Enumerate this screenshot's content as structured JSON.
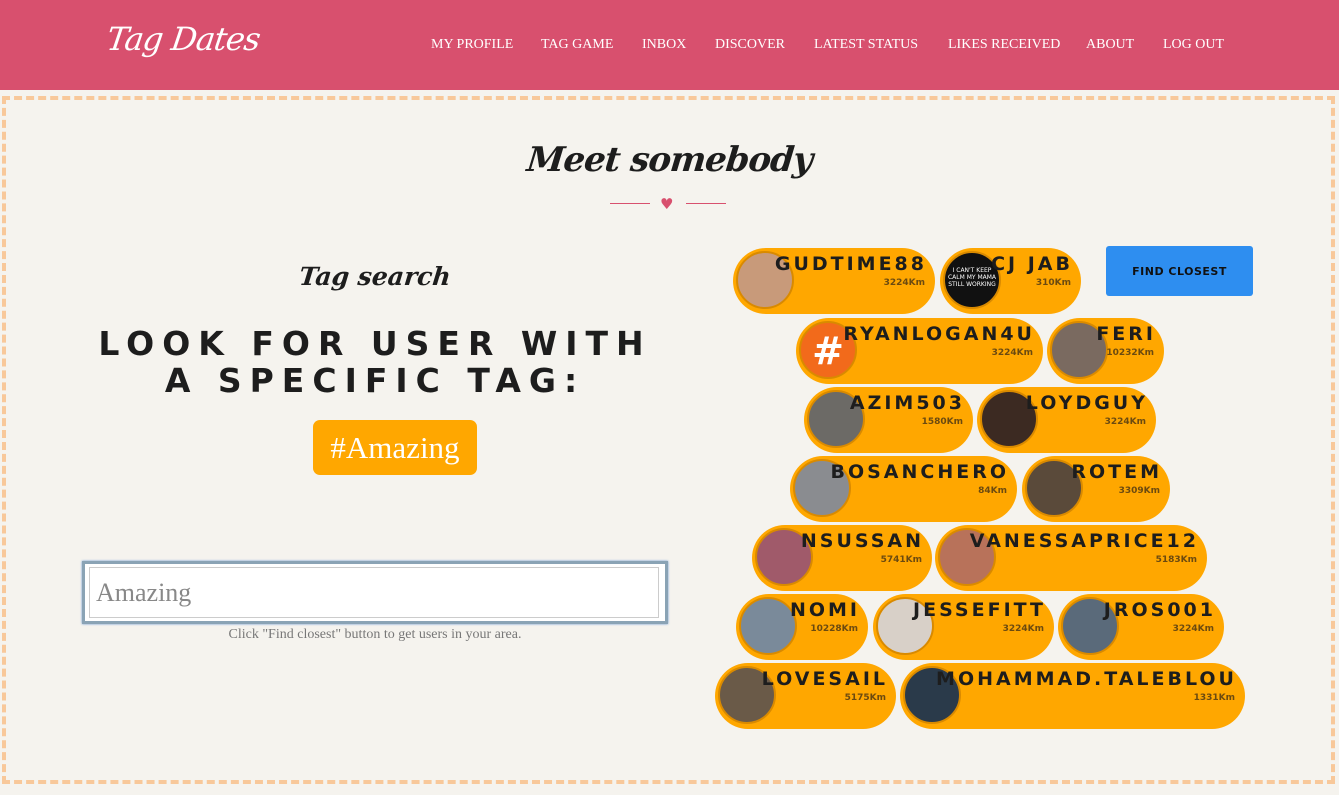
{
  "header": {
    "logo": "Tag Dates",
    "nav": [
      "MY PROFILE",
      "TAG GAME",
      "INBOX",
      "DISCOVER",
      "LATEST STATUS",
      "LIKES RECEIVED",
      "ABOUT",
      "LOG OUT"
    ]
  },
  "main": {
    "title": "Meet somebody",
    "tag_search_heading": "Tag search",
    "look_for_text": "LOOK FOR USER WITH A SPECIFIC TAG:",
    "current_tag": "#Amazing",
    "search_input_value": "Amazing",
    "hint": "Click \"Find closest\" button to get users in your area.",
    "find_closest_label": "FIND CLOSEST"
  },
  "users": [
    {
      "name": "GUDTIME88",
      "distance": "3224Km",
      "avatar_color": "#c89a7a"
    },
    {
      "name": "CJ JAB",
      "distance": "310Km",
      "avatar_color": "#111111",
      "avatar_text": "I CAN'T KEEP CALM MY MAMA STILL WORKING"
    },
    {
      "name": "RYANLOGAN4U",
      "distance": "3224Km",
      "avatar_color": "#f26a1b",
      "avatar_icon": "#"
    },
    {
      "name": "FERI",
      "distance": "10232Km",
      "avatar_color": "#7a6a60"
    },
    {
      "name": "AZIM503",
      "distance": "1580Km",
      "avatar_color": "#6c6a66"
    },
    {
      "name": "LOYDGUY",
      "distance": "3224Km",
      "avatar_color": "#3c2a22"
    },
    {
      "name": "BOSANCHERO",
      "distance": "84Km",
      "avatar_color": "#8a8c90"
    },
    {
      "name": "ROTEM",
      "distance": "3309Km",
      "avatar_color": "#5a4a3a"
    },
    {
      "name": "NSUSSAN",
      "distance": "5741Km",
      "avatar_color": "#a05a6a"
    },
    {
      "name": "VANESSAPRICE12",
      "distance": "5183Km",
      "avatar_color": "#b8725a"
    },
    {
      "name": "NOMI",
      "distance": "10228Km",
      "avatar_color": "#7a8a9a"
    },
    {
      "name": "JESSEFITT",
      "distance": "3224Km",
      "avatar_color": "#d8d0c8"
    },
    {
      "name": "JROS001",
      "distance": "3224Km",
      "avatar_color": "#5a6a7a"
    },
    {
      "name": "LOVESAIL",
      "distance": "5175Km",
      "avatar_color": "#6a5a48"
    },
    {
      "name": "MOHAMMAD.TALEBLOU",
      "distance": "1331Km",
      "avatar_color": "#2a3a4a"
    }
  ],
  "colors": {
    "header_bg": "#d8506e",
    "accent_orange": "#ffa700",
    "button_blue": "#2e8ef0",
    "frame_dash": "#f8c89a"
  }
}
